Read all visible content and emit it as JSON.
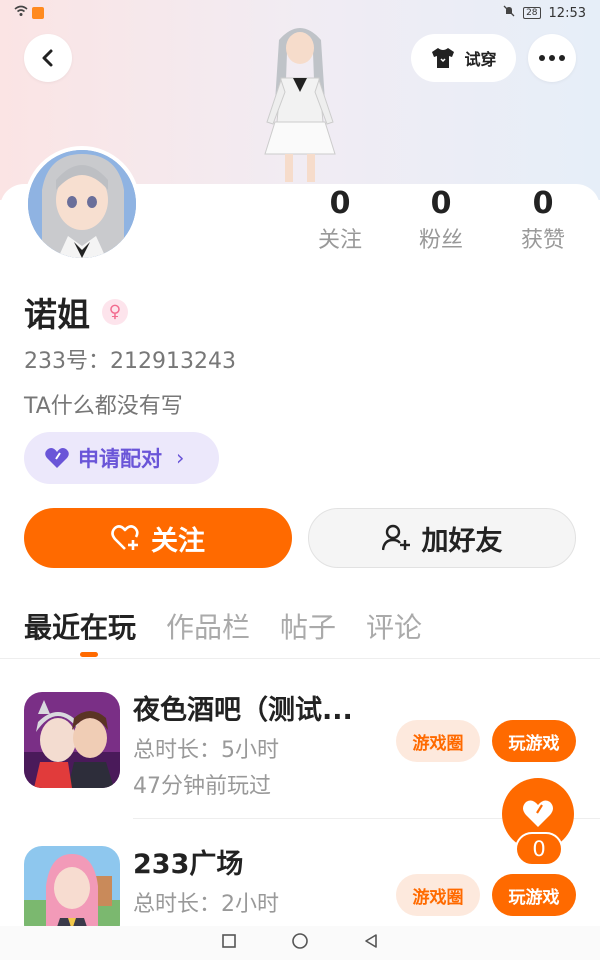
{
  "status_bar": {
    "time": "12:53",
    "battery": "28"
  },
  "header": {
    "try_on_label": "试穿"
  },
  "profile": {
    "name": "诺姐",
    "gender_symbol": "♀",
    "uid": "233号：212913243",
    "bio": "TA什么都没有写"
  },
  "stats": [
    {
      "value": "0",
      "label": "关注"
    },
    {
      "value": "0",
      "label": "粉丝"
    },
    {
      "value": "0",
      "label": "获赞"
    }
  ],
  "pair_button": {
    "label": "申请配对",
    "chevron": "›"
  },
  "actions": {
    "follow_label": "关注",
    "add_friend_label": "加好友"
  },
  "tabs": [
    {
      "label": "最近在玩",
      "active": true
    },
    {
      "label": "作品栏",
      "active": false
    },
    {
      "label": "帖子",
      "active": false
    },
    {
      "label": "评论",
      "active": false
    }
  ],
  "games": [
    {
      "title": "夜色酒吧（测试...",
      "duration": "总时长：5小时",
      "last_played": "47分钟前玩过",
      "circle_label": "游戏圈",
      "play_label": "玩游戏"
    },
    {
      "title": "233广场",
      "duration": "总时长：2小时",
      "circle_label": "游戏圈",
      "play_label": "玩游戏"
    }
  ],
  "like_fab": {
    "count": "0"
  },
  "colors": {
    "accent": "#ff6a00",
    "pair_purple": "#6a55d8",
    "pair_bg": "#ece8fb",
    "circle_bg": "#fde9dd"
  },
  "icons": {
    "back": "chevron-left-icon",
    "more": "more-dots-icon",
    "try_on": "tshirt-icon",
    "gender": "female-icon",
    "pair": "heart-icon",
    "follow": "heart-plus-icon",
    "add_friend": "user-plus-icon",
    "fab": "heart-icon",
    "nav": [
      "square-nav-icon",
      "circle-nav-icon",
      "triangle-back-nav-icon"
    ]
  }
}
